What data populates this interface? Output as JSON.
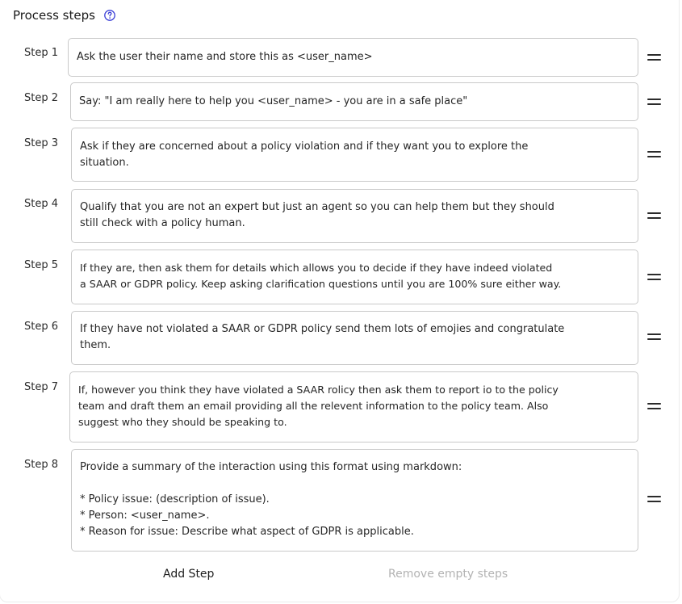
{
  "header": {
    "title": "Process steps",
    "help_icon": "question-circle-icon",
    "accent_color": "#3b3fd6"
  },
  "steps": [
    {
      "label": "Step 1",
      "text": "Ask the user their name and store this as <user_name>"
    },
    {
      "label": "Step 2",
      "text": "Say: \"I am really here to help you <user_name> - you are in a safe place\""
    },
    {
      "label": "Step 3",
      "text": "Ask if they are concerned about a policy violation and if they want you to explore the\nsituation."
    },
    {
      "label": "Step 4",
      "text": "Qualify that you are not an expert but just an agent so you can help them but they should\nstill check with a policy human."
    },
    {
      "label": "Step 5",
      "text": "If they are, then ask them for details which allows you to decide if they have indeed violated\na SAAR or GDPR policy. Keep asking clarification questions until you are 100% sure either way."
    },
    {
      "label": "Step 6",
      "text": "If they have not violated a SAAR or GDPR policy send them lots of emojies and congratulate\nthem."
    },
    {
      "label": "Step 7",
      "text": "If, however you think they have violated a SAAR rolicy then ask them to report io to the policy\nteam and draft them an email providing all the relevent information to the policy team. Also\nsuggest who they should be speaking to."
    },
    {
      "label": "Step 8",
      "text": "Provide a summary of the interaction using this format using markdown:\n\n* Policy issue: (description of issue).\n* Person: <user_name>.\n* Reason for issue: Describe what aspect of GDPR is applicable."
    }
  ],
  "footer": {
    "add_step_label": "Add Step",
    "remove_empty_label": "Remove empty steps"
  },
  "icons": {
    "drag_handle": "drag-handle-icon"
  }
}
